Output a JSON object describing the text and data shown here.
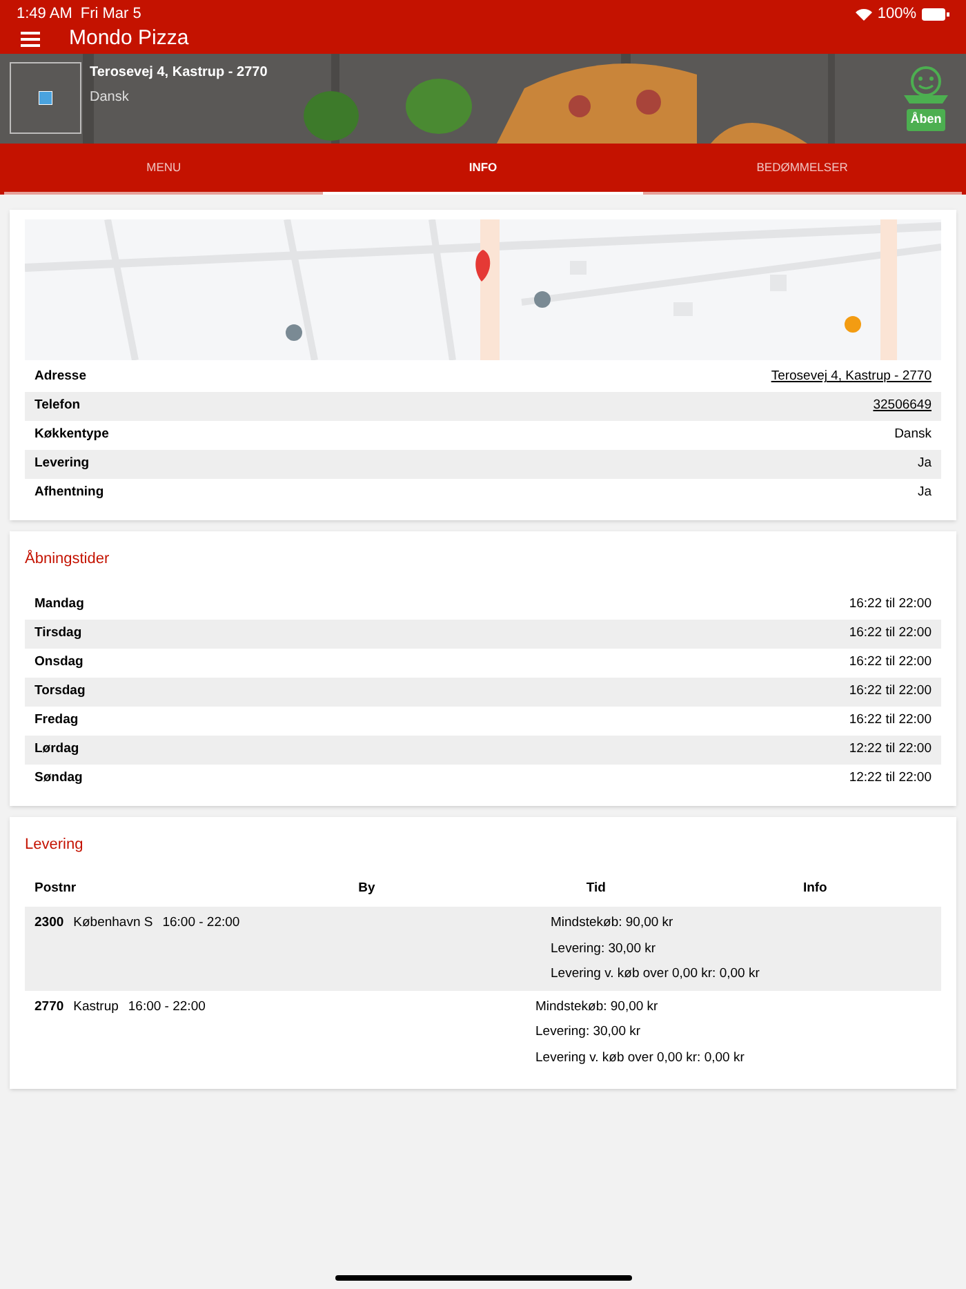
{
  "status_bar": {
    "time": "1:49 AM",
    "date": "Fri Mar 5",
    "battery": "100%"
  },
  "app_bar": {
    "title": "Mondo Pizza"
  },
  "header": {
    "address": "Terosevej 4, Kastrup - 2770",
    "cuisine": "Dansk",
    "badge": "Åben",
    "open": true
  },
  "tabs": [
    {
      "label": "MENU",
      "selected": false
    },
    {
      "label": "INFO",
      "selected": true
    },
    {
      "label": "BEDØMMELSER",
      "selected": false
    }
  ],
  "info": {
    "rows": [
      {
        "label": "Adresse",
        "value": "Terosevej 4, Kastrup - 2770",
        "link": true
      },
      {
        "label": "Telefon",
        "value": "32506649",
        "link": true
      },
      {
        "label": "Køkkentype",
        "value": "Dansk",
        "link": false
      },
      {
        "label": "Levering",
        "value": "Ja",
        "link": false
      },
      {
        "label": "Afhentning",
        "value": "Ja",
        "link": false
      }
    ]
  },
  "opening_hours": {
    "title": "Åbningstider",
    "rows": [
      {
        "day": "Mandag",
        "hours": "16:22 til 22:00"
      },
      {
        "day": "Tirsdag",
        "hours": "16:22 til 22:00"
      },
      {
        "day": "Onsdag",
        "hours": "16:22 til 22:00"
      },
      {
        "day": "Torsdag",
        "hours": "16:22 til 22:00"
      },
      {
        "day": "Fredag",
        "hours": "16:22 til 22:00"
      },
      {
        "day": "Lørdag",
        "hours": "12:22 til 22:00"
      },
      {
        "day": "Søndag",
        "hours": "12:22 til 22:00"
      }
    ]
  },
  "delivery": {
    "title": "Levering",
    "columns": [
      "Postnr",
      "By",
      "Tid",
      "Info"
    ],
    "rows": [
      {
        "postnr": "2300",
        "city": "København S",
        "time": "16:00 - 22:00",
        "info": [
          "Mindstekøb: 90,00 kr",
          "Levering: 30,00 kr",
          "Levering v. køb over 0,00 kr: 0,00 kr"
        ]
      },
      {
        "postnr": "2770",
        "city": "Kastrup",
        "time": "16:00 - 22:00",
        "info": [
          "Mindstekøb: 90,00 kr",
          "Levering: 30,00 kr",
          "Levering v. køb over 0,00 kr: 0,00 kr"
        ]
      }
    ]
  }
}
